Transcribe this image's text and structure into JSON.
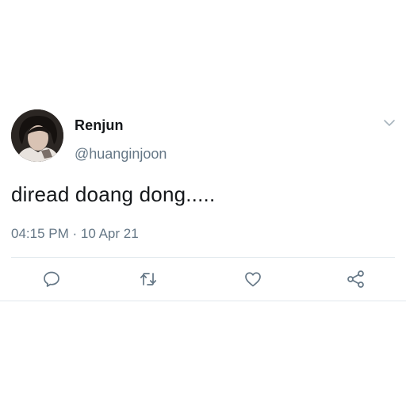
{
  "user": {
    "display_name": "Renjun",
    "handle": "@huanginjoon"
  },
  "tweet": {
    "text": "diread doang dong.....",
    "timestamp": "04:15 PM · 10 Apr 21"
  },
  "icons": {
    "menu": "chevron-down-icon",
    "reply": "reply-icon",
    "retweet": "retweet-icon",
    "like": "heart-icon",
    "share": "share-icon"
  },
  "colors": {
    "text_primary": "#14171a",
    "text_secondary": "#657786",
    "icon": "#657786",
    "divider": "#e1e8ed"
  }
}
